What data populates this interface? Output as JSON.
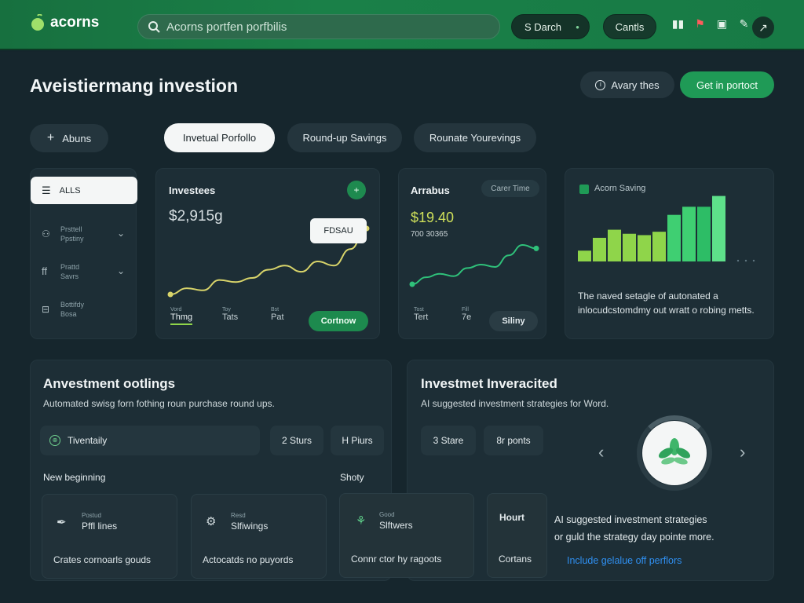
{
  "app": {
    "name": "acorns"
  },
  "header": {
    "search_placeholder": "Acorns portfen porfbilis",
    "search_button": "S Darch",
    "contacts_button": "Cantls",
    "icons": [
      "chart-icon",
      "flag-icon",
      "clipboard-icon",
      "edit-icon",
      "share-icon"
    ]
  },
  "page": {
    "title": "Aveistiermang investion",
    "actions": {
      "secondary": "Avary thes",
      "primary": "Get in portoct"
    }
  },
  "tabs": {
    "add": "Abuns",
    "items": [
      "Invetual Porfollo",
      "Round-up Savings",
      "Rounate Yourevings"
    ],
    "active_index": 0
  },
  "sidebar": {
    "active": "ALLS",
    "items": [
      {
        "line1": "Prsttell",
        "line2": "Ppstiny"
      },
      {
        "line1": "Prattd",
        "line2": "Savrs"
      },
      {
        "line1": "Bottifdy",
        "line2": "Bosa"
      }
    ]
  },
  "invest_card": {
    "title": "Investees",
    "amount": "$2,915g",
    "tooltip": "FDSAU",
    "tabs": [
      {
        "small": "Vord",
        "label": "Thmg"
      },
      {
        "small": "Toy",
        "label": "Tats"
      },
      {
        "small": "Bst",
        "label": "Pat"
      }
    ],
    "cta": "Cortnow",
    "chart_data": {
      "type": "line",
      "x": [
        0,
        1,
        2,
        3,
        4,
        5,
        6,
        7,
        8,
        9,
        10,
        11,
        12
      ],
      "values": [
        2,
        5,
        4,
        9,
        8,
        10,
        14,
        16,
        13,
        18,
        16,
        24,
        34
      ]
    }
  },
  "arabus_card": {
    "title": "Arrabus",
    "badge": "Carer Time",
    "amount": "$19.40",
    "sub": "700 30365",
    "tabs": [
      {
        "small": "Tost",
        "label": "Tert"
      },
      {
        "small": "Fill",
        "label": "7e"
      }
    ],
    "cta": "Siliny",
    "chart_data": {
      "type": "line",
      "x": [
        0,
        1,
        2,
        3,
        4,
        5,
        6,
        7,
        8,
        9
      ],
      "values": [
        2,
        8,
        11,
        9,
        16,
        19,
        17,
        27,
        36,
        33
      ]
    }
  },
  "savings_card": {
    "legend": "Acorn Saving",
    "description": "The naved setagle of autonated a inlocudcstomdmy out wratt o robing metts.",
    "chart_data": {
      "type": "bar",
      "values": [
        16,
        35,
        47,
        41,
        39,
        44,
        69,
        81,
        81,
        97
      ],
      "ylim": [
        0,
        100
      ]
    }
  },
  "options": {
    "title": "Anvestment ootlings",
    "subtitle": "Automated swisg forn fothing roun purchase round ups.",
    "chips": [
      "Tiventaily",
      "2 Sturs",
      "H Piurs"
    ],
    "row_left": "New beginning",
    "row_right": "Shoty",
    "tiles": [
      {
        "small": "Postud",
        "title": "Pffl lines",
        "footer": "Crates cornoarls gouds"
      },
      {
        "small": "Resd",
        "title": "Slfiwings",
        "footer": "Actocatds no puyords"
      },
      {
        "small": "Good",
        "title": "Slftwers",
        "footer": "Connr ctor hy ragoots"
      }
    ]
  },
  "ai": {
    "title": "Investmet Inveracited",
    "subtitle": "AI suggested investment strategies for Word.",
    "chips": [
      "3 Stare",
      "8r ponts"
    ],
    "tile": {
      "top": "Hourt",
      "bottom": "Cortans"
    },
    "body": [
      "AI suggested investment strategies",
      "or guld the strategy day pointe more."
    ],
    "link": "Include gelalue off perflors"
  },
  "colors": {
    "brand": "#1a8048",
    "accent": "#1f9a56",
    "chart_line": "#d8d46a",
    "bar_green": "#8fd54a",
    "link": "#2f8ff0"
  }
}
